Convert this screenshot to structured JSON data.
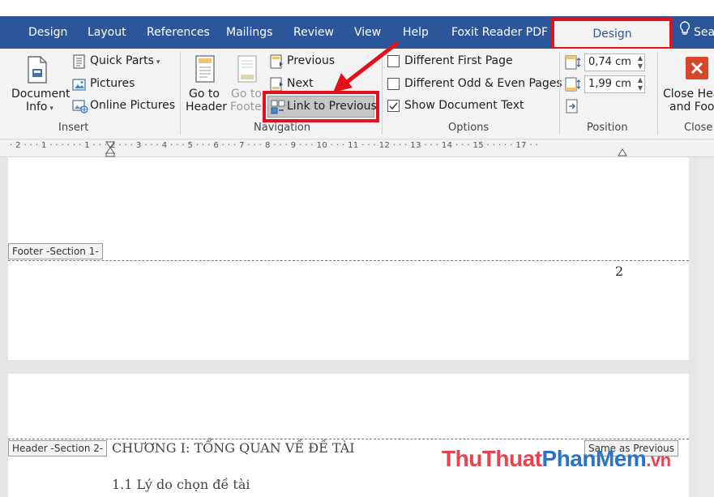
{
  "tabs": [
    "Design",
    "Layout",
    "References",
    "Mailings",
    "Review",
    "View",
    "Help",
    "Foxit Reader PDF"
  ],
  "active_tab": "Design",
  "search_tab": "Sea",
  "insert_group": {
    "document_info": [
      "Document",
      "Info"
    ],
    "quick_parts": "Quick Parts",
    "pictures": "Pictures",
    "online_pictures": "Online Pictures",
    "label": "Insert"
  },
  "navigation_group": {
    "goto_header": [
      "Go to",
      "Header"
    ],
    "goto_footer": [
      "Go to",
      "Footer"
    ],
    "previous": "Previous",
    "next": "Next",
    "link_to_previous": "Link to Previous",
    "label": "Navigation"
  },
  "options_group": {
    "different_first_page": "Different First Page",
    "different_odd_even": "Different Odd & Even Pages",
    "show_document_text": "Show Document Text",
    "show_document_text_checked": true,
    "label": "Options"
  },
  "position_group": {
    "header_from_top": "0,74 cm",
    "footer_from_bottom": "1,99 cm",
    "label": "Position"
  },
  "close_group": {
    "close_button": [
      "Close Hea",
      "and Foo"
    ],
    "label": "Close"
  },
  "ruler_text": "· 2 · · · 1 · · ·   · · · 1 · · · 2 · · · 3 · · · 4 · · · 5 · · · 6 · · · 7 · · · 8 · · · 9 · · · 10 · · · 11 · · · 12 · · · 13 · · · 14 · · · 15 · · ·   · · 17 · ·",
  "document": {
    "footer_tag": "Footer -Section 1-",
    "page_number": "2",
    "header_tag": "Header -Section 2-",
    "same_as_previous": "Same as Previous",
    "chapter_title": "CHƯƠNG I: TỔNG QUAN VỀ ĐỀ TÀI",
    "section_title": "1.1 Lý do chọn đề tài"
  },
  "watermark": {
    "part1": "ThuThuat",
    "part2": "PhanMem",
    "part3": ".vn"
  },
  "colors": {
    "ribbon_blue": "#2b579a",
    "highlight_red": "#e0121c",
    "watermark_red": "#e8434f",
    "watermark_blue": "#2b73c5"
  }
}
